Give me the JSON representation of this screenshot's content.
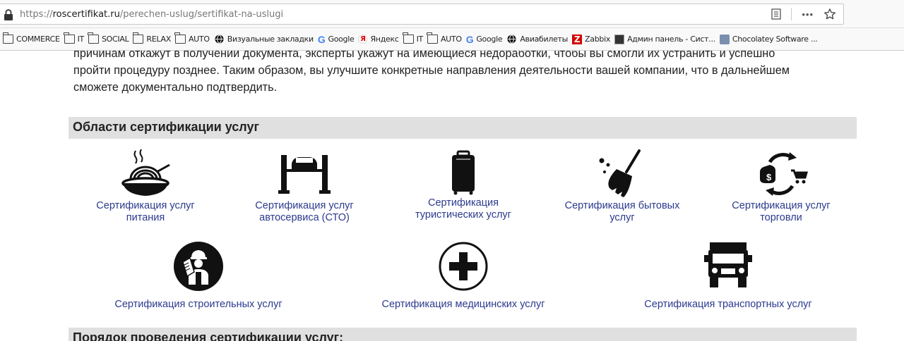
{
  "browser": {
    "url_scheme": "https://",
    "url_host": "roscertifikat.ru",
    "url_path": "/perechen-uslug/sertifikat-na-uslugi",
    "reader_icon": "reader-mode-icon",
    "more_label": "•••",
    "star_icon": "star-icon"
  },
  "bookmarks": [
    {
      "label": "COMMERCE",
      "icon": "folder-icon"
    },
    {
      "label": "IT",
      "icon": "folder-icon"
    },
    {
      "label": "SOCIAL",
      "icon": "folder-icon"
    },
    {
      "label": "RELAX",
      "icon": "folder-icon"
    },
    {
      "label": "AUTO",
      "icon": "folder-icon"
    },
    {
      "label": "Визуальные закладки",
      "icon": "globe-icon"
    },
    {
      "label": "Google",
      "icon": "google-icon"
    },
    {
      "label": "Яндекс",
      "icon": "yandex-icon"
    },
    {
      "label": "IT",
      "icon": "folder-icon"
    },
    {
      "label": "AUTO",
      "icon": "folder-icon"
    },
    {
      "label": "Google",
      "icon": "google-icon"
    },
    {
      "label": "Авиабилеты",
      "icon": "globe-icon"
    },
    {
      "label": "Zabbix",
      "icon": "zabbix-icon"
    },
    {
      "label": "Админ панель - Сист...",
      "icon": "admin-icon"
    },
    {
      "label": "Chocolatey Software ...",
      "icon": "chocolatey-icon"
    }
  ],
  "intro": {
    "line1": "причинам откажут в получении документа, эксперты укажут на имеющиеся недоработки, чтобы вы смогли их устранить и успешно",
    "line2": "пройти процедуру позднее. Таким образом, вы улучшите конкретные направления деятельности вашей компании, что в дальнейшем",
    "line3": "сможете документально подтвердить."
  },
  "section1_title": "Области сертификации услуг",
  "services": [
    {
      "line1": "Сертификация услуг",
      "line2": "питания",
      "icon": "food-bowl-icon"
    },
    {
      "line1": "Сертификация услуг",
      "line2": "автосервиса (СТО)",
      "icon": "car-lift-icon"
    },
    {
      "line1": "Сертификация",
      "line2": "туристических услуг",
      "icon": "suitcase-icon"
    },
    {
      "line1": "Сертификация бытовых",
      "line2": "услуг",
      "icon": "broom-icon"
    },
    {
      "line1": "Сертификация услуг",
      "line2": "торговли",
      "icon": "trade-cycle-icon"
    },
    {
      "line1": "Сертификация строительных услуг",
      "icon": "builder-icon"
    },
    {
      "line1": "Сертификация медицинских услуг",
      "icon": "medical-cross-icon"
    },
    {
      "line1": "Сертификация транспортных услуг",
      "icon": "truck-icon"
    }
  ],
  "section2_title": "Порядок проведения сертификации услуг:"
}
